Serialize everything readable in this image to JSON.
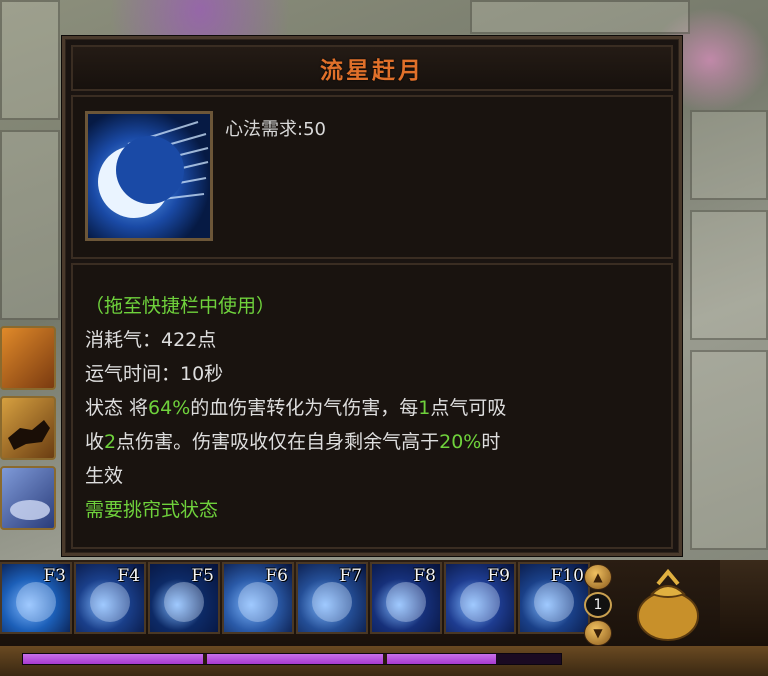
{
  "tooltip": {
    "title": "流星赶月",
    "requirement": "心法需求:50",
    "usage_hint": "（拖至快捷栏中使用）",
    "cost": "消耗气：422点",
    "cast_time": "运气时间：10秒",
    "status": {
      "p1": "状态 将",
      "pct1": "64%",
      "p2": "的血伤害转化为气伤害，每",
      "n1": "1",
      "p3": "点气可吸",
      "p4": "收",
      "n2": "2",
      "p5": "点伤害。伤害吸收仅在自身剩余气高于",
      "pct2": "20%",
      "p6": "时",
      "p7": "生效"
    },
    "stance_requirement": "需要挑帘式状态"
  },
  "hotbar": {
    "slots": [
      {
        "key": "F3",
        "icon": "crescent-moon-icon",
        "color": "#1c5fb8"
      },
      {
        "key": "F4",
        "icon": "warrior-leap-icon",
        "color": "#1a3f8a"
      },
      {
        "key": "F5",
        "icon": "blue-orb-icon",
        "color": "#0d2a66"
      },
      {
        "key": "F6",
        "icon": "lightning-sword-icon",
        "color": "#2a5aa8"
      },
      {
        "key": "F7",
        "icon": "pointing-finger-icon",
        "color": "#244e96"
      },
      {
        "key": "F8",
        "icon": "energy-burst-icon",
        "color": "#16307a"
      },
      {
        "key": "F9",
        "icon": "comet-icon",
        "color": "#1e3c90"
      },
      {
        "key": "F10",
        "icon": "spirit-figure-icon",
        "color": "#1a4088"
      }
    ],
    "page_number": "1",
    "mana_fraction": 0.88,
    "accent_mana": "#a83ad0"
  },
  "colors": {
    "title": "#e0702a",
    "highlight": "#6fd23c",
    "text": "#dedede"
  }
}
